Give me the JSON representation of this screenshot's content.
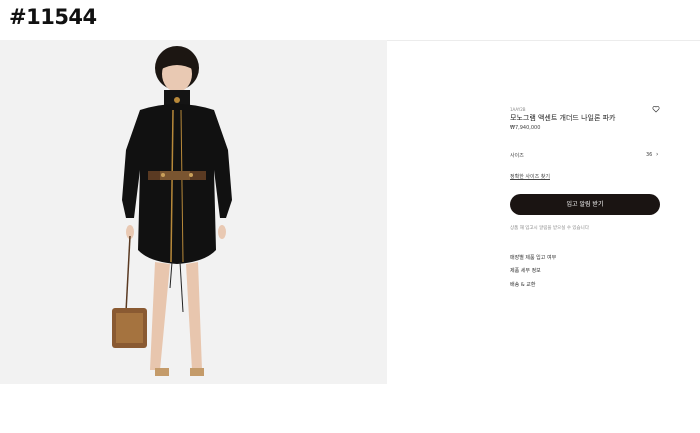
{
  "header": {
    "tag": "#11544"
  },
  "product": {
    "sku": "1AAY2B",
    "title": "모노그램 액센트 개더드 나일론 파카",
    "price": "₩7,940,000",
    "wishlist_icon": "heart-icon"
  },
  "size": {
    "label": "사이즈",
    "value": "36",
    "chevron_icon": "chevron-right-icon"
  },
  "find_size": "정확한 사이즈 찾기",
  "cta": {
    "label": "입고 알림 받기"
  },
  "note": "상품 재 입고시 알림을 받으실 수 있습니다",
  "links": [
    "매장별 제품 입고 여부",
    "제품 세부 정보",
    "배송 & 교환"
  ],
  "colors": {
    "cta_bg": "#1a1412",
    "photo_bg": "#f3f3f3"
  }
}
